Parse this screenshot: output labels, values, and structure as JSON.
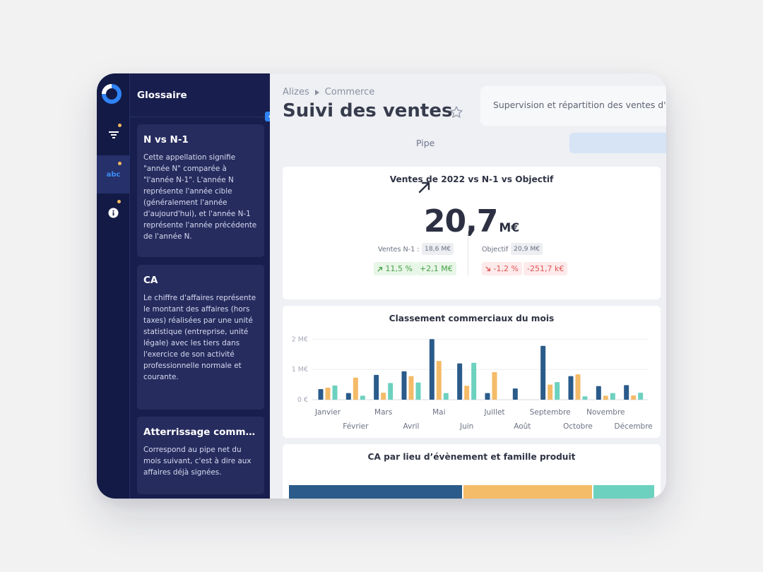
{
  "glossary": {
    "title": "Glossaire",
    "cards": [
      {
        "title": "N vs N-1",
        "text": "Cette appellation signifie \"année N\" comparée à \"l'année N-1\". L'année N représente l'année cible (généralement l'année d'aujourd'hui), et l'année N-1 représente l'année précédente de l'année N."
      },
      {
        "title": "CA",
        "text": "Le chiffre d'affaires représente le montant des affaires (hors taxes) réalisées par une unité statistique (entreprise, unité légale) avec les tiers dans l'exercice de son activité professionnelle normale et courante."
      },
      {
        "title": "Atterrissage comme...",
        "text": "Correspond au pipe net du mois suivant, c'est à dire aux affaires déjà signées."
      }
    ]
  },
  "rail": {
    "abc_label": "abc",
    "accent_color": "#2f84f6",
    "dot_color": "#f4b860"
  },
  "breadcrumb": {
    "root": "Alizes",
    "section": "Commerce"
  },
  "page": {
    "title": "Suivi des ventes",
    "description": "Supervision et répartition des ventes d'A"
  },
  "tabs": {
    "pipe": "Pipe"
  },
  "kpi": {
    "title": "Ventes de 2022 vs N-1 vs Objectif",
    "value": "20,7",
    "unit": "M€",
    "n1_label": "Ventes N-1 :",
    "n1_value": "18,6 M€",
    "objectif_label": "Objectif",
    "objectif_value": "20,9 M€",
    "n1_pct": "11,5 %",
    "n1_delta": "+2,1 M€",
    "obj_pct": "-1,2 %",
    "obj_delta": "-251,7 k€"
  },
  "chart_data": {
    "type": "bar",
    "title": "Classement commerciaux du mois",
    "categories": [
      "Janvier",
      "Février",
      "Mars",
      "Avril",
      "Mai",
      "Juin",
      "Juillet",
      "Août",
      "Septembre",
      "Octobre",
      "Novembre",
      "Décembre"
    ],
    "series": [
      {
        "color": "#2a5b8a",
        "values": [
          0.35,
          0.22,
          0.82,
          0.94,
          2.0,
          1.2,
          0.22,
          0.37,
          1.78,
          0.78,
          0.45,
          0.48
        ]
      },
      {
        "color": "#f4bb68",
        "values": [
          0.4,
          0.73,
          0.23,
          0.78,
          1.28,
          0.46,
          0.91,
          0.0,
          0.5,
          0.84,
          0.13,
          0.14
        ]
      },
      {
        "color": "#6dd1bf",
        "values": [
          0.47,
          0.13,
          0.55,
          0.57,
          0.22,
          1.22,
          0.0,
          0.0,
          0.58,
          0.11,
          0.22,
          0.23
        ]
      }
    ],
    "yticks": [
      "0 €",
      "1 M€",
      "2 M€"
    ],
    "ylim": [
      0,
      2.1
    ]
  },
  "bottom_panel": {
    "title": "CA par lieu d’évènement et famille produit",
    "colors": [
      "#2a5b8a",
      "#f4bb68",
      "#6dd1bf"
    ]
  }
}
